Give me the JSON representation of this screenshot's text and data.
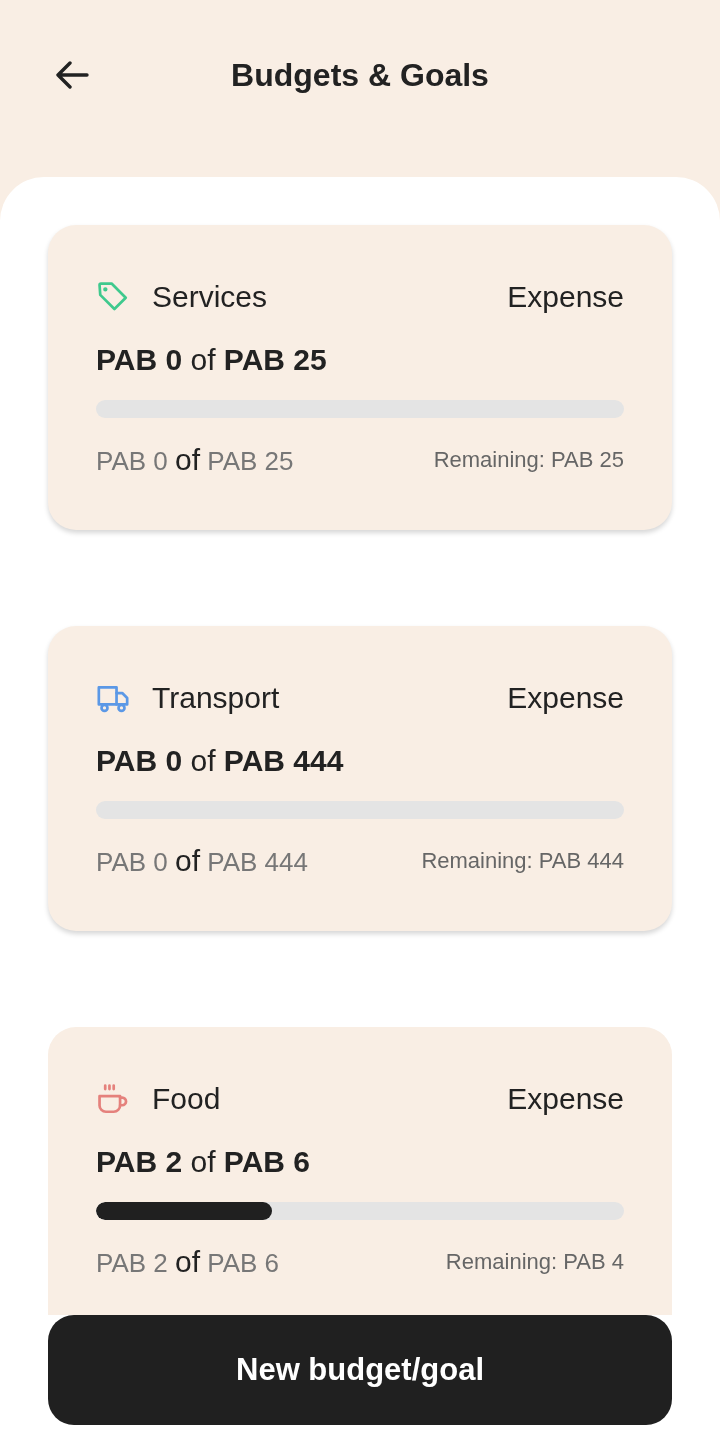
{
  "header": {
    "title": "Budgets & Goals"
  },
  "cards": [
    {
      "kind": "tag",
      "color": "#3fc98d",
      "name": "Services",
      "type": "Expense",
      "amount": "**PAB 0** of **PAB 25**",
      "level": 0,
      "spent": "PAB 0",
      "joiner": "of",
      "total": "PAB 25",
      "remaining": "Remaining: PAB 25"
    },
    {
      "kind": "truck",
      "color": "#5b98e6",
      "name": "Transport",
      "type": "Expense",
      "amount": "**PAB 0** of **PAB 444**",
      "level": 0,
      "spent": "PAB 0",
      "joiner": "of",
      "total": "PAB 444",
      "remaining": "Remaining: PAB 444"
    },
    {
      "kind": "cup",
      "color": "#e5817c",
      "name": "Food",
      "type": "Expense",
      "amount": "**PAB 2** of **PAB 6**",
      "level": 0.333,
      "spent": "PAB 2",
      "joiner": "of",
      "total": "PAB 6",
      "remaining": "Remaining: PAB 4"
    }
  ],
  "action_button": {
    "label": "New budget/goal"
  }
}
